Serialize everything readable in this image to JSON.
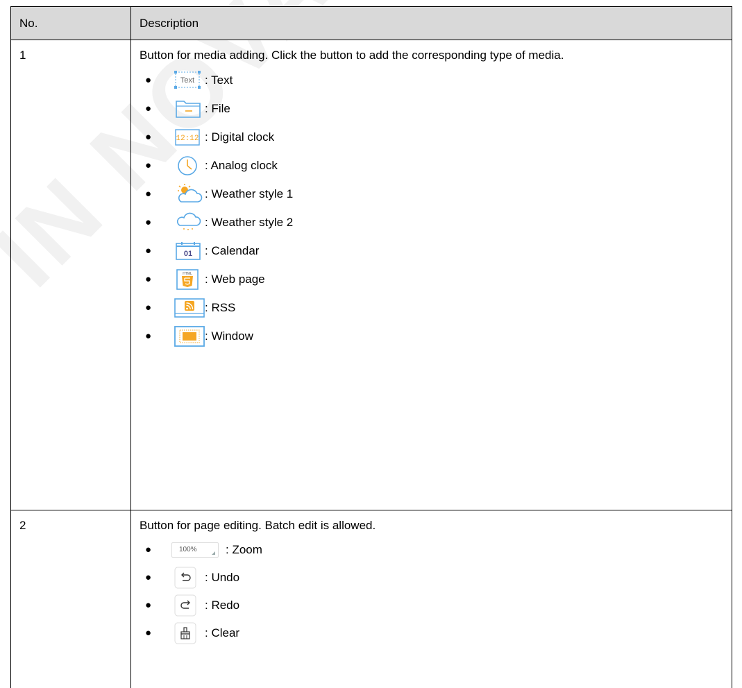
{
  "watermark": "IN NOVASTAR TEC",
  "table": {
    "headers": [
      "No.",
      "Description"
    ],
    "rows": [
      {
        "no": "1",
        "description": "Button for media adding. Click the button to add the corresponding type of media.",
        "items": [
          {
            "icon": "text-icon",
            "icon_text": "Text",
            "label": ": Text"
          },
          {
            "icon": "folder-icon",
            "label": ": File"
          },
          {
            "icon": "digital-clock-icon",
            "icon_text": "12:12",
            "label": ": Digital clock"
          },
          {
            "icon": "analog-clock-icon",
            "label": ": Analog clock"
          },
          {
            "icon": "weather-sun-cloud-icon",
            "label": ": Weather style 1"
          },
          {
            "icon": "weather-cloud-rain-icon",
            "label": ": Weather style 2"
          },
          {
            "icon": "calendar-icon",
            "icon_text": "01",
            "label": ": Calendar"
          },
          {
            "icon": "html-page-icon",
            "icon_text": "HTML",
            "label": ": Web page"
          },
          {
            "icon": "rss-icon",
            "label": ": RSS"
          },
          {
            "icon": "window-icon",
            "label": ": Window"
          }
        ]
      },
      {
        "no": "2",
        "description": "Button for page editing. Batch edit is allowed.",
        "items": [
          {
            "icon": "zoom-dropdown-icon",
            "icon_text": "100%",
            "label": ": Zoom"
          },
          {
            "icon": "undo-icon",
            "label": ": Undo"
          },
          {
            "icon": "redo-icon",
            "label": ": Redo"
          },
          {
            "icon": "clear-brush-icon",
            "label": ": Clear"
          }
        ]
      }
    ]
  },
  "colors": {
    "header_bg": "#d9d9d9",
    "icon_blue": "#5aa9e6",
    "icon_orange": "#f5a623"
  }
}
